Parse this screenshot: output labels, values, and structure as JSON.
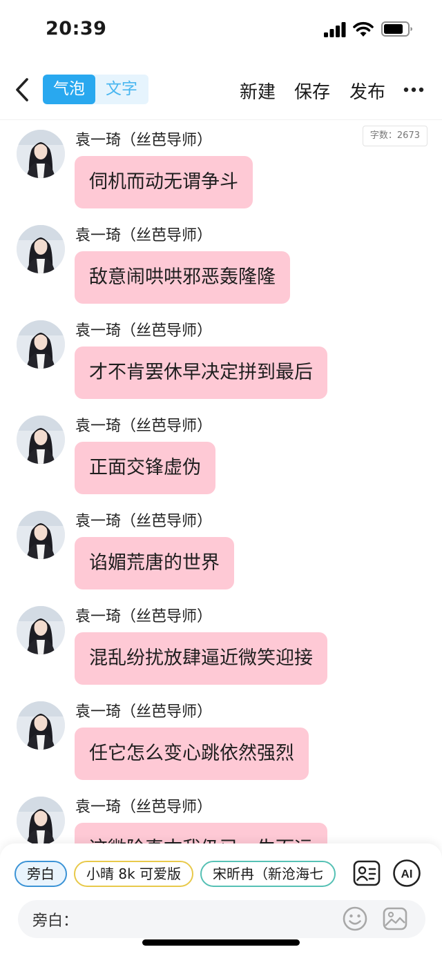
{
  "status_bar": {
    "time": "20:39"
  },
  "nav": {
    "tabs": [
      {
        "label": "气泡",
        "active": true
      },
      {
        "label": "文字",
        "active": false
      }
    ],
    "new_label": "新建",
    "save_label": "保存",
    "publish_label": "发布"
  },
  "chat": {
    "word_count": "字数：2673",
    "messages": [
      {
        "sender": "袁一琦（丝芭导师）",
        "text": "伺机而动无谓争斗"
      },
      {
        "sender": "袁一琦（丝芭导师）",
        "text": "敌意闹哄哄邪恶轰隆隆"
      },
      {
        "sender": "袁一琦（丝芭导师）",
        "text": "才不肯罢休早决定拼到最后"
      },
      {
        "sender": "袁一琦（丝芭导师）",
        "text": "正面交锋虚伪"
      },
      {
        "sender": "袁一琦（丝芭导师）",
        "text": "谄媚荒唐的世界"
      },
      {
        "sender": "袁一琦（丝芭导师）",
        "text": "混乱纷扰放肆逼近微笑迎接"
      },
      {
        "sender": "袁一琦（丝芭导师）",
        "text": "任它怎么变心跳依然强烈"
      },
      {
        "sender": "袁一琦（丝芭导师）",
        "text": "这微险真古我仍已一生而远"
      }
    ]
  },
  "composer": {
    "roles": [
      {
        "label": "旁白",
        "style": "active"
      },
      {
        "label": "小晴 8k 可爱版",
        "style": "yellow"
      },
      {
        "label": "宋昕冉（新沧海七",
        "style": "teal"
      }
    ],
    "ai_label": "AI",
    "input_label": "旁白："
  },
  "colors": {
    "accent": "#29a8ef",
    "bubble": "#fec9d5",
    "segment_bg": "#e6f4fd"
  },
  "icons": [
    "back-chevron-icon",
    "more-icon",
    "contact-card-icon",
    "ai-icon",
    "emoji-icon",
    "image-icon",
    "signal-icon",
    "wifi-icon",
    "battery-icon"
  ]
}
